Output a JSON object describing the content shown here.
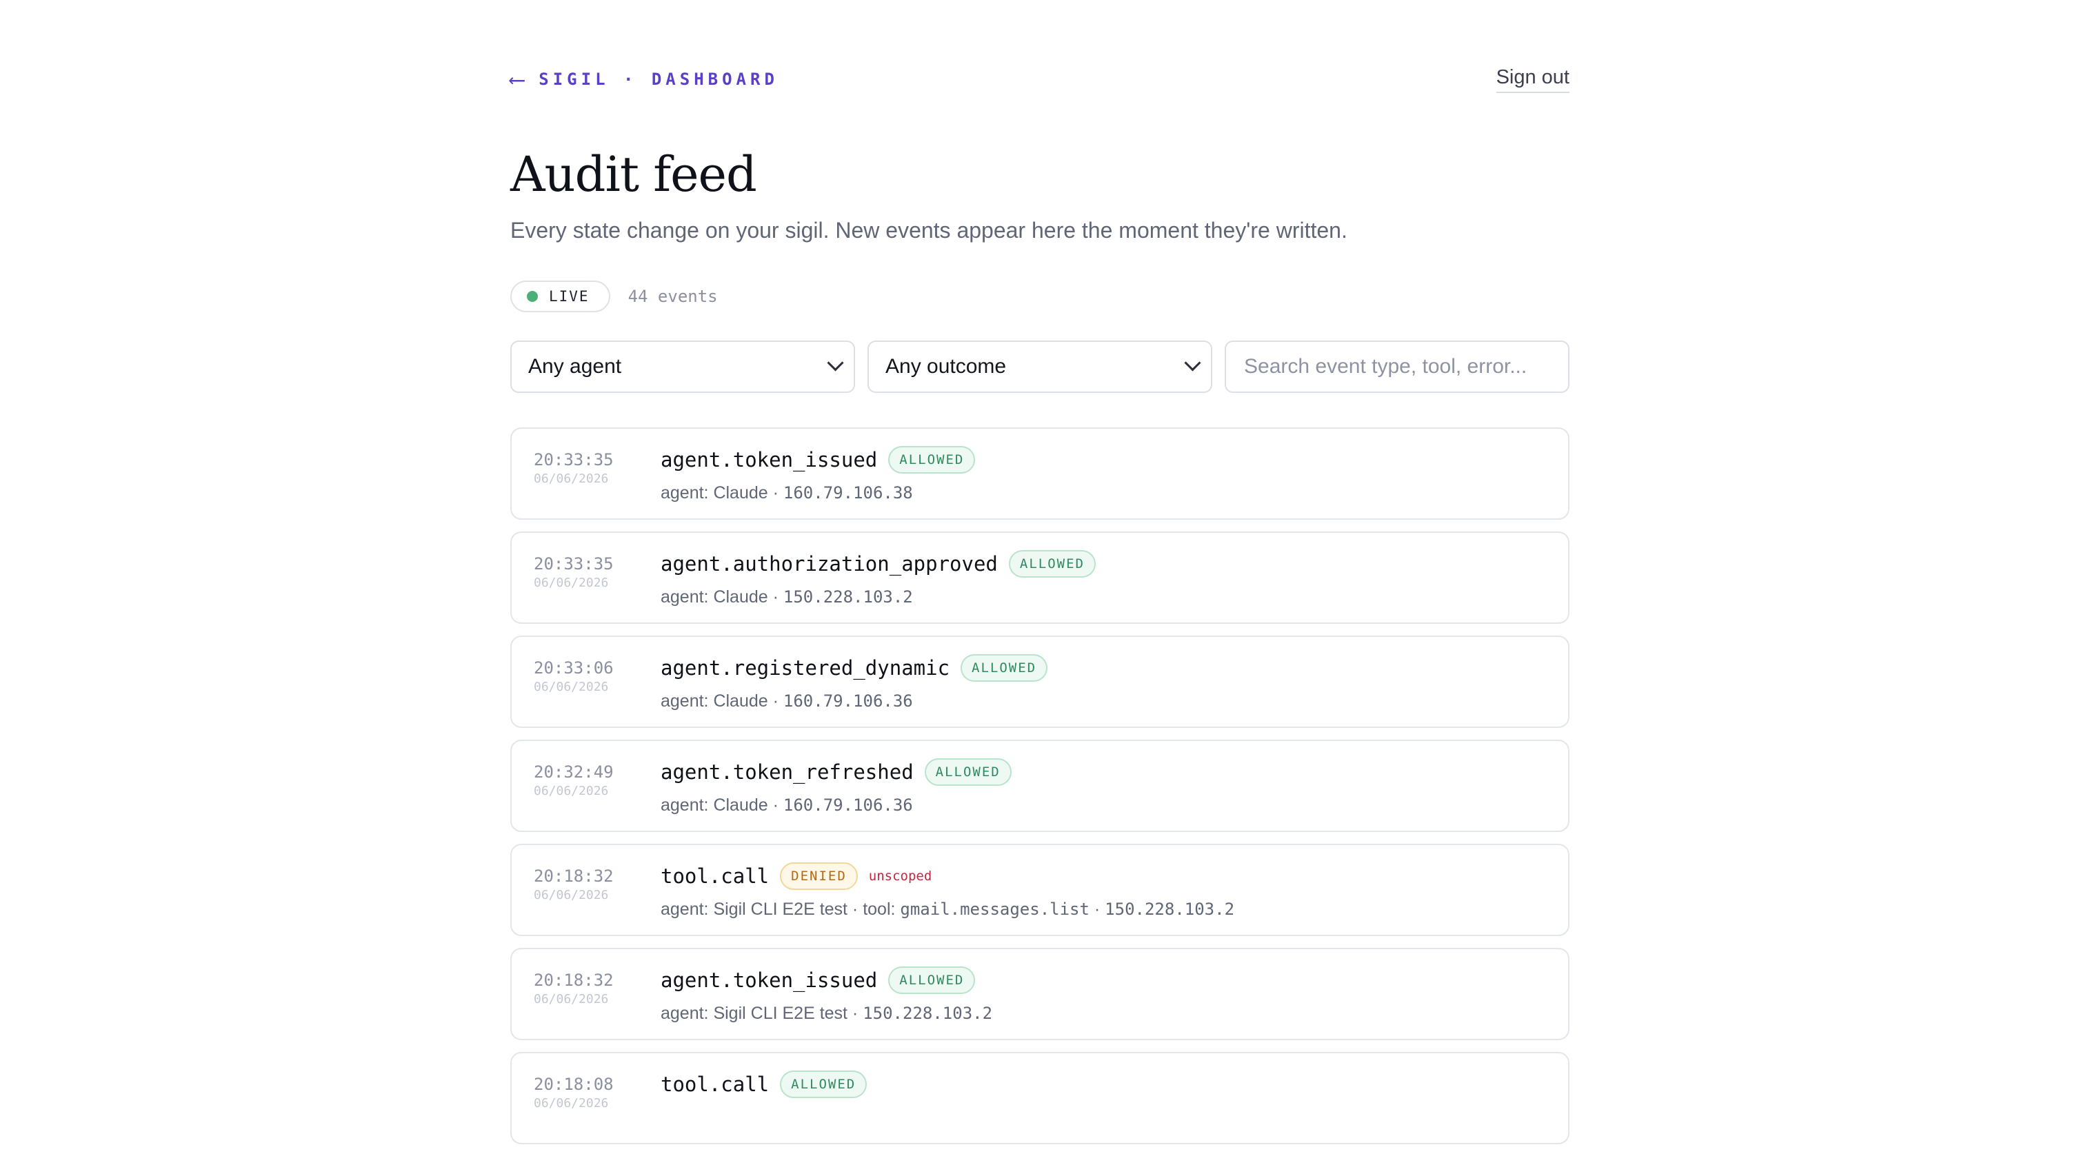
{
  "header": {
    "back_arrow": "⟵",
    "back_label": "SIGIL · DASHBOARD",
    "signout_label": "Sign out"
  },
  "page": {
    "title": "Audit feed",
    "subtitle": "Every state change on your sigil. New events appear here the moment they're written."
  },
  "status": {
    "live_label": "LIVE",
    "event_count": "44 events"
  },
  "filters": {
    "agent_selected": "Any agent",
    "outcome_selected": "Any outcome",
    "search_placeholder": "Search event type, tool, error..."
  },
  "colors": {
    "accent": "#5b3fc4",
    "allowed": "#2f8a5e",
    "denied": "#b36a12",
    "error": "#c2283f",
    "live": "#4caf7a"
  },
  "events": [
    {
      "time": "20:33:35",
      "date": "06/06/2026",
      "type": "agent.token_issued",
      "outcome": "ALLOWED",
      "reason": "",
      "agent": "agent: Claude",
      "tool": "",
      "ip": "160.79.106.38"
    },
    {
      "time": "20:33:35",
      "date": "06/06/2026",
      "type": "agent.authorization_approved",
      "outcome": "ALLOWED",
      "reason": "",
      "agent": "agent: Claude",
      "tool": "",
      "ip": "150.228.103.2"
    },
    {
      "time": "20:33:06",
      "date": "06/06/2026",
      "type": "agent.registered_dynamic",
      "outcome": "ALLOWED",
      "reason": "",
      "agent": "agent: Claude",
      "tool": "",
      "ip": "160.79.106.36"
    },
    {
      "time": "20:32:49",
      "date": "06/06/2026",
      "type": "agent.token_refreshed",
      "outcome": "ALLOWED",
      "reason": "",
      "agent": "agent: Claude",
      "tool": "",
      "ip": "160.79.106.36"
    },
    {
      "time": "20:18:32",
      "date": "06/06/2026",
      "type": "tool.call",
      "outcome": "DENIED",
      "reason": "unscoped",
      "agent": "agent: Sigil CLI E2E test",
      "tool_prefix": "tool: ",
      "tool": "gmail.messages.list",
      "ip": "150.228.103.2"
    },
    {
      "time": "20:18:32",
      "date": "06/06/2026",
      "type": "agent.token_issued",
      "outcome": "ALLOWED",
      "reason": "",
      "agent": "agent: Sigil CLI E2E test",
      "tool": "",
      "ip": "150.228.103.2"
    },
    {
      "time": "20:18:08",
      "date": "06/06/2026",
      "type": "tool.call",
      "outcome": "ALLOWED",
      "reason": "",
      "agent": "",
      "tool": "",
      "ip": ""
    }
  ],
  "separator": " · "
}
